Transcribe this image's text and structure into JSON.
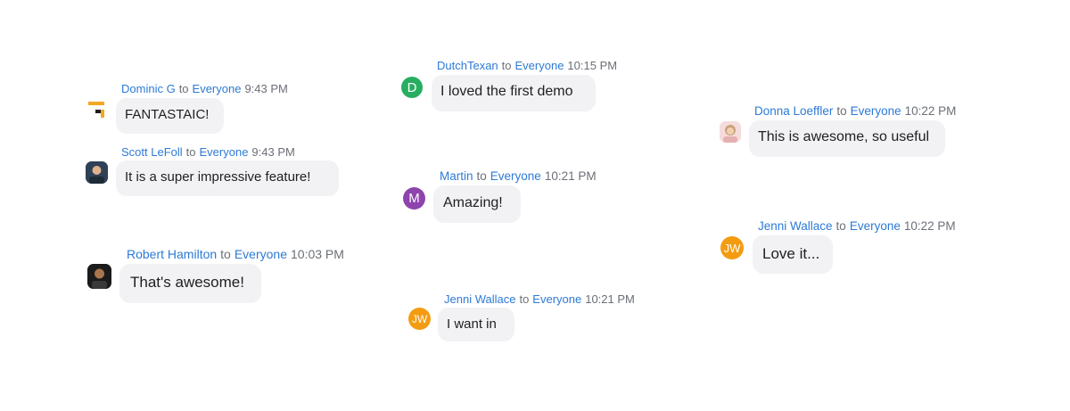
{
  "to_label": "to",
  "messages": [
    {
      "sender": "Dominic G",
      "target": "Everyone",
      "time": "9:43 PM",
      "text": "FANTASTAIC!",
      "avatar": {
        "type": "logo",
        "color": "#f5a623",
        "accent": "#1d1d1d"
      }
    },
    {
      "sender": "Scott LeFoll",
      "target": "Everyone",
      "time": "9:43 PM",
      "text": "It is a super impressive feature!",
      "avatar": {
        "type": "photo",
        "color": "#34495e",
        "accent": "#e0b28c"
      }
    },
    {
      "sender": "Robert Hamilton",
      "target": "Everyone",
      "time": "10:03 PM",
      "text": "That's awesome!",
      "avatar": {
        "type": "photo",
        "color": "#1b1b1b",
        "accent": "#a8754f"
      }
    },
    {
      "sender": "DutchTexan",
      "target": "Everyone",
      "time": "10:15 PM",
      "text": "I loved the first demo",
      "avatar": {
        "type": "initial",
        "initials": "D",
        "color": "#27ae60"
      }
    },
    {
      "sender": "Martin",
      "target": "Everyone",
      "time": "10:21 PM",
      "text": "Amazing!",
      "avatar": {
        "type": "initial",
        "initials": "M",
        "color": "#8e44ad"
      }
    },
    {
      "sender": "Jenni Wallace",
      "target": "Everyone",
      "time": "10:21 PM",
      "text": "I want in",
      "avatar": {
        "type": "initial",
        "initials": "JW",
        "color": "#f39c12"
      }
    },
    {
      "sender": "Donna Loeffler",
      "target": "Everyone",
      "time": "10:22 PM",
      "text": "This is awesome, so useful",
      "avatar": {
        "type": "photo",
        "color": "#f1c8c8",
        "accent": "#c9a27a"
      }
    },
    {
      "sender": "Jenni Wallace",
      "target": "Everyone",
      "time": "10:22 PM",
      "text": "Love it...",
      "avatar": {
        "type": "initial",
        "initials": "JW",
        "color": "#f39c12"
      }
    }
  ]
}
